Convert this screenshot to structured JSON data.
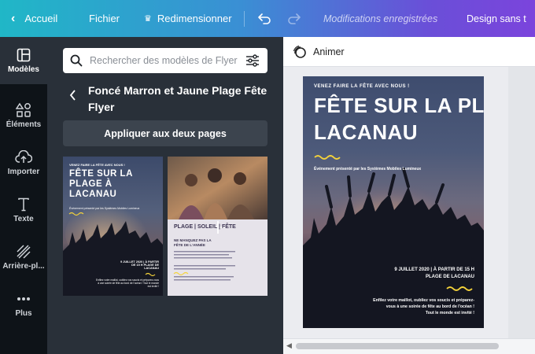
{
  "topbar": {
    "back_label": "Accueil",
    "file_label": "Fichier",
    "resize_label": "Redimensionner",
    "saved_label": "Modifications enregistrées",
    "design_label": "Design sans t"
  },
  "leftnav": {
    "items": [
      {
        "label": "Modèles",
        "icon": "layout-icon",
        "active": true
      },
      {
        "label": "Éléments",
        "icon": "shapes-icon",
        "active": false
      },
      {
        "label": "Importer",
        "icon": "upload-icon",
        "active": false
      },
      {
        "label": "Texte",
        "icon": "text-icon",
        "active": false
      },
      {
        "label": "Arrière-pl...",
        "icon": "background-icon",
        "active": false
      },
      {
        "label": "Plus",
        "icon": "more-icon",
        "active": false
      }
    ]
  },
  "panel": {
    "search_placeholder": "Rechercher des modèles de Flyer (",
    "template_title": "Foncé Marron et Jaune Plage Fête Flyer",
    "apply_label": "Appliquer aux deux pages",
    "thumb1": {
      "small": "VENEZ FAIRE LA FÊTE AVEC NOUS !",
      "title": "FÊTE SUR LA PLAGE À LACANAU",
      "sub": "Événement présenté par les Systèmes Mobiles Lumineux",
      "date": "9 JUILLET 2020 | À PARTIR DE 15 H PLAGE DE LACANAU",
      "body": "Enfilez votre maillot, oubliez vos soucis et préparez-vous à une soirée de fête au bord de l'océan ! Tout le monde est invité !"
    },
    "thumb2": {
      "title": "PLAGE | SOLEIL | FÊTE",
      "subtitle": "NE MANQUEZ PAS LA FÊTE DE L'ANNÉE"
    }
  },
  "editor": {
    "animate_label": "Animer"
  },
  "flyer": {
    "small_top": "VENEZ FAIRE LA FÊTE AVEC NOUS !",
    "title_line1": "FÊTE SUR LA PLAGE À",
    "title_line2": "LACANAU",
    "presenter": "Événement présenté par les Systèmes Mobiles Lumineux",
    "date_line1": "9 JUILLET 2020 | À PARTIR DE 15 H",
    "date_line2": "PLAGE DE LACANAU",
    "body_line1": "Enfilez votre maillot, oubliez vos soucis et préparez-",
    "body_line2": "vous à une soirée de fête au bord de l'océan !",
    "body_line3": "Tout le monde est invité !"
  },
  "colors": {
    "accent_yellow": "#f5d33a",
    "panel_bg": "#293039",
    "nav_bg": "#0e1318"
  }
}
